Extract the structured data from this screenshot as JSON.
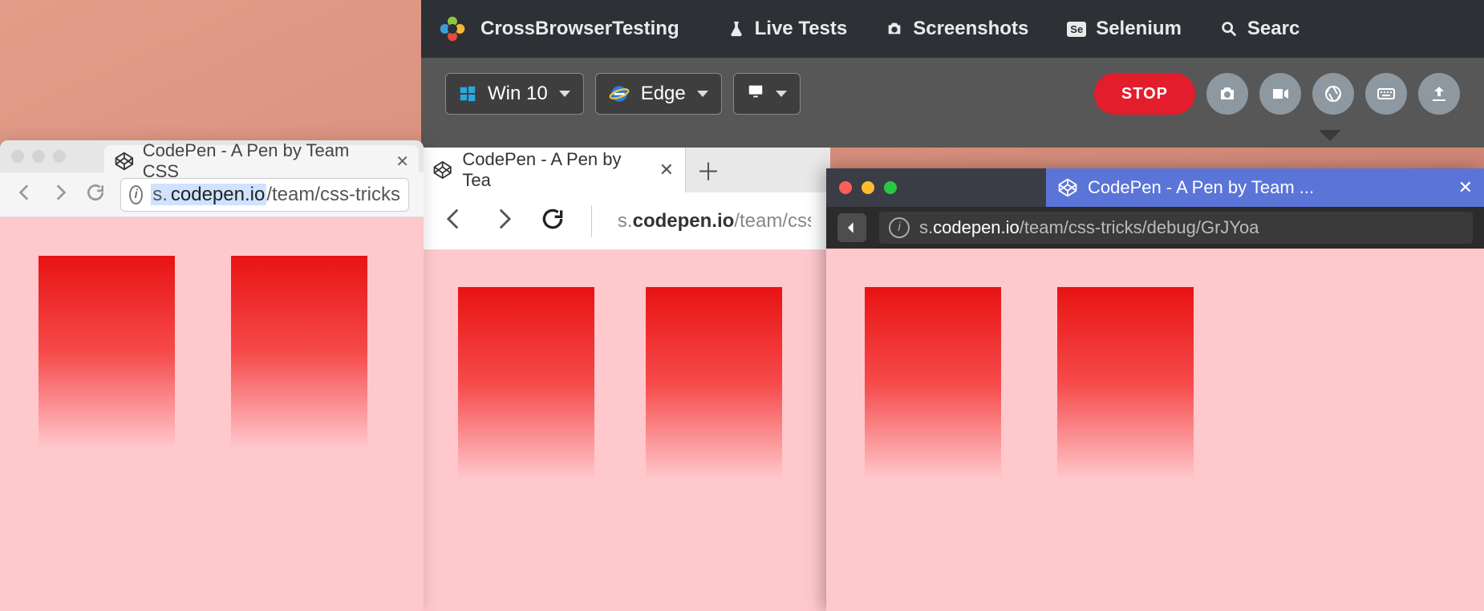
{
  "cbt": {
    "brand": "CrossBrowserTesting",
    "nav": {
      "live": "Live Tests",
      "screenshots": "Screenshots",
      "selenium": "Selenium",
      "selenium_badge": "Se",
      "search": "Searc"
    },
    "toolbar": {
      "os": "Win 10",
      "browser": "Edge",
      "stop": "STOP"
    }
  },
  "mac_chrome": {
    "tab_title": "CodePen - A Pen by Team CSS",
    "url_prefix": "s.",
    "url_domain": "codepen.io",
    "url_path": "/team/css-tricks"
  },
  "edge": {
    "tab_title": "CodePen - A Pen by Tea",
    "url_prefix": "s.",
    "url_domain": "codepen.io",
    "url_path": "/team/css-t"
  },
  "firefox": {
    "tab_title": "CodePen - A Pen by Team ...",
    "url_prefix": "s.",
    "url_domain": "codepen.io",
    "url_path": "/team/css-tricks/debug/GrJYoa"
  }
}
